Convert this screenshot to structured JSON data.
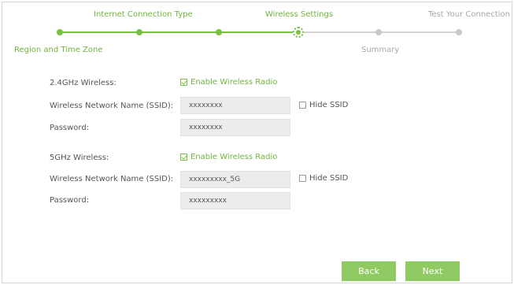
{
  "steps": {
    "region": "Region and Time Zone",
    "internet": "Internet Connection Type",
    "wireless": "Wireless Settings",
    "summary": "Summary",
    "test": "Test Your Connection"
  },
  "colors": {
    "accent": "#79c140",
    "inactive": "#c9c9c9",
    "button": "#8fcb62"
  },
  "band24": {
    "label": "2.4GHz Wireless:",
    "enable_label": "Enable Wireless Radio",
    "enabled": true,
    "ssid_label": "Wireless Network Name (SSID):",
    "ssid_value": "xxxxxxxx",
    "hide_ssid_label": "Hide SSID",
    "hide_ssid_checked": false,
    "password_label": "Password:",
    "password_value": "xxxxxxxx"
  },
  "band5": {
    "label": "5GHz Wireless:",
    "enable_label": "Enable Wireless Radio",
    "enabled": true,
    "ssid_label": "Wireless Network Name (SSID):",
    "ssid_value": "xxxxxxxxx_5G",
    "hide_ssid_label": "Hide SSID",
    "hide_ssid_checked": false,
    "password_label": "Password:",
    "password_value": "xxxxxxxxx"
  },
  "buttons": {
    "back": "Back",
    "next": "Next"
  }
}
